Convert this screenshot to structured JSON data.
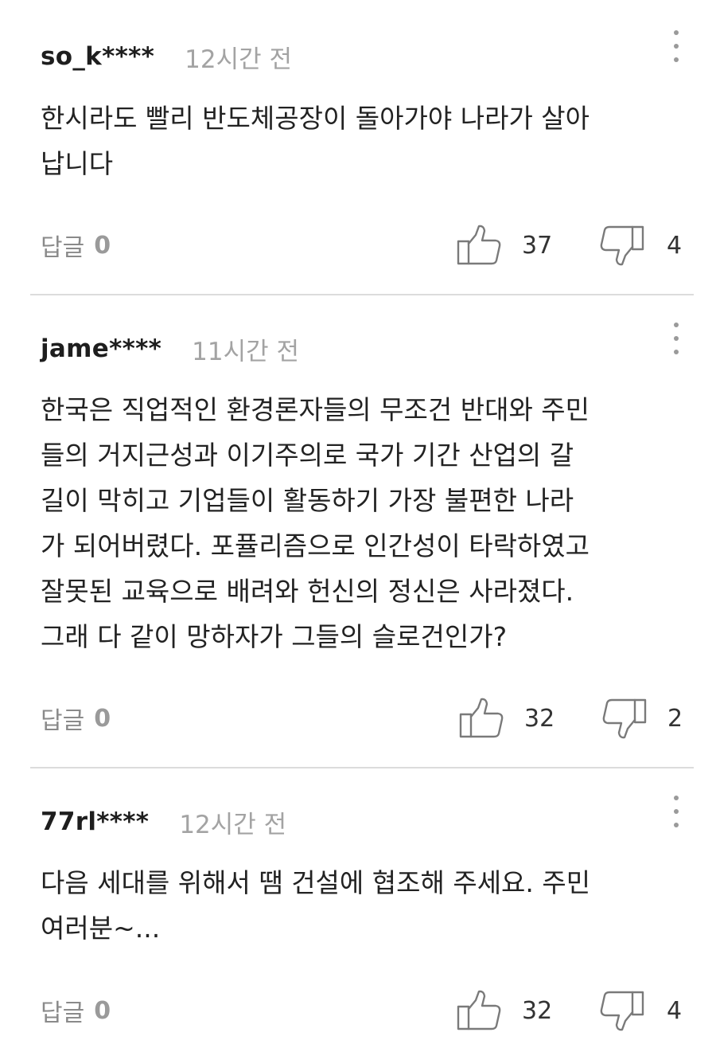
{
  "comments": [
    {
      "username": "so_k****",
      "time": "12시간 전",
      "lines": [
        "한시라도 빨리 반도체공장이 돌아가야 나라가 살아",
        "납니다"
      ],
      "reply_label": "답글",
      "reply_count": "0",
      "likes": "37",
      "dislikes": "4"
    },
    {
      "username": "jame****",
      "time": "11시간 전",
      "lines": [
        "한국은 직업적인 환경론자들의 무조건 반대와 주민",
        "들의 거지근성과 이기주의로 국가 기간 산업의 갈",
        "길이 막히고 기업들이 활동하기 가장 불편한 나라",
        "가 되어버렸다. 포퓰리즘으로 인간성이 타락하였고",
        "잘못된 교육으로 배려와 헌신의 정신은 사라졌다.",
        "그래 다 같이 망하자가 그들의 슬로건인가?"
      ],
      "reply_label": "답글",
      "reply_count": "0",
      "likes": "32",
      "dislikes": "2"
    },
    {
      "username": "77rl****",
      "time": "12시간 전",
      "lines": [
        "다음 세대를 위해서 땜 건설에 협조해 주세요. 주민",
        "여러분~..."
      ],
      "reply_label": "답글",
      "reply_count": "0",
      "likes": "32",
      "dislikes": "4"
    }
  ],
  "icons": {
    "like": "thumbs-up-icon",
    "dislike": "thumbs-down-icon",
    "more": "more-vertical-icon"
  },
  "colors": {
    "username": "#1e1e1e",
    "timestamp": "#a3a3a3",
    "body_text": "#222222",
    "reply_text": "#8a8a8a",
    "icon_stroke": "#7a7a7a",
    "divider": "#dcdcdc"
  }
}
